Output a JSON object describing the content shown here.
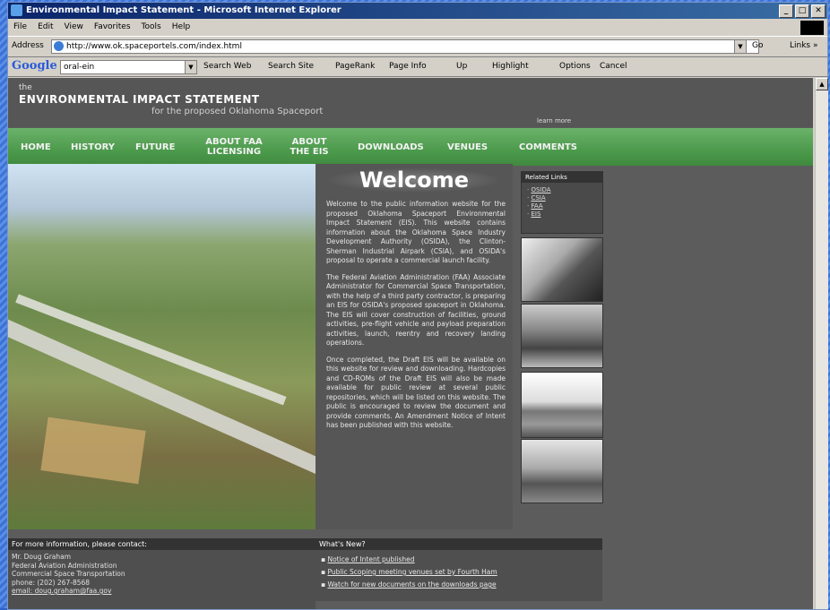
{
  "window": {
    "title": "Environmental Impact Statement - Microsoft Internet Explorer",
    "buttons": [
      "_",
      "□",
      "✕"
    ]
  },
  "menu": [
    "File",
    "Edit",
    "View",
    "Favorites",
    "Tools",
    "Help"
  ],
  "address_bar": {
    "label": "Address",
    "url": "http://www.ok.spaceportels.com/index.html",
    "go": "Go",
    "links": "Links »"
  },
  "google_bar": {
    "logo": "Google",
    "query": "oral-ein",
    "tools": [
      "Search Web",
      "Search Site",
      "PageRank",
      "Page Info",
      "Up",
      "Highlight",
      "Options",
      "Cancel"
    ]
  },
  "site": {
    "the": "the",
    "title": "ENVIRONMENTAL IMPACT STATEMENT",
    "subtitle": "for the proposed Oklahoma Spaceport",
    "learn_more": "learn more",
    "nav": [
      {
        "label": "HOME"
      },
      {
        "label": "HISTORY"
      },
      {
        "label": "FUTURE"
      },
      {
        "label": "ABOUT FAA LICENSING"
      },
      {
        "label": "ABOUT THE EIS"
      },
      {
        "label": "DOWNLOADS"
      },
      {
        "label": "VENUES"
      },
      {
        "label": "COMMENTS"
      }
    ],
    "welcome_title": "Welcome",
    "welcome_paragraphs": [
      "Welcome to the public information website for the proposed Oklahoma Spaceport Environmental Impact Statement (EIS). This website contains information about the Oklahoma Space Industry Development Authority (OSIDA), the Clinton-Sherman Industrial Airpark (CSIA), and OSIDA's proposal to operate a commercial launch facility.",
      "The Federal Aviation Administration (FAA) Associate Administrator for Commercial Space Transportation, with the help of a third party contractor, is preparing an EIS for OSIDA's proposed spaceport in Oklahoma. The EIS will cover construction of facilities, ground activities, pre-flight vehicle and payload preparation activities, launch, reentry and recovery landing operations.",
      "Once completed, the Draft EIS will be available on this website for review and downloading. Hardcopies and CD-ROMs of the Draft EIS will also be made available for public review at several public repositories, which will be listed on this website. The public is encouraged to review the document and provide comments. An Amendment Notice of Intent has been published with this website."
    ],
    "related_links": {
      "heading": "Related Links",
      "items": [
        "OSIDA",
        "CSIA",
        "FAA",
        "EIS"
      ]
    },
    "contact": {
      "heading": "For more information, please contact:",
      "lines": [
        "Mr. Doug Graham",
        "Federal Aviation Administration",
        "Commercial Space Transportation",
        "phone: (202) 267-8568",
        "email: doug.graham@faa.gov"
      ]
    },
    "whats_new": {
      "heading": "What's New?",
      "items": [
        "Notice of Intent published",
        "Public Scoping meeting venues set by Fourth Ham",
        "Watch for new documents on the downloads page"
      ]
    }
  }
}
